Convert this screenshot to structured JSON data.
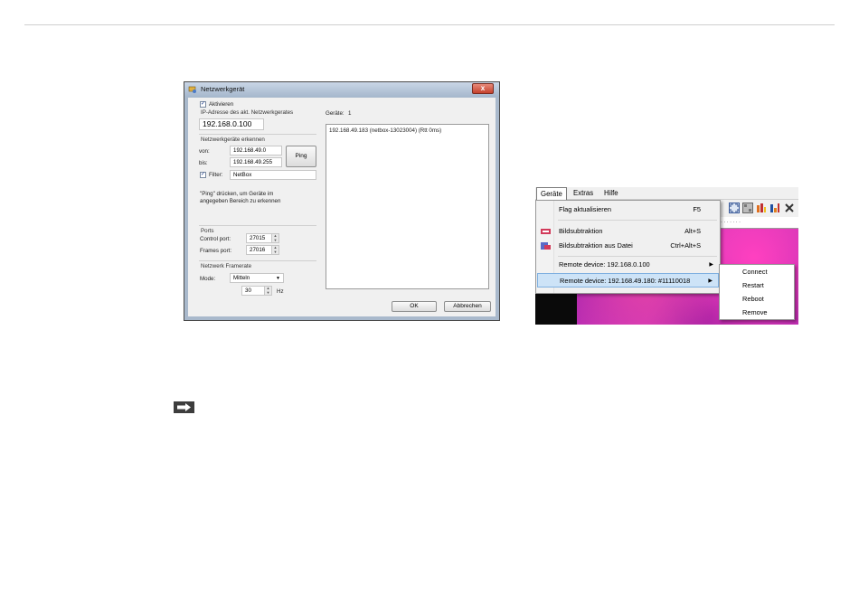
{
  "dialog": {
    "title": "Netzwerkgerät",
    "close_label": "x",
    "activate_label": "Aktivieren",
    "ip_section_label": "IP-Adresse des akt. Netzwerkgerates",
    "ip_value": "192.168.0.100",
    "discover_section_label": "Netzwerkgeräte erkennen",
    "from_label": "von:",
    "from_value": "192.168.49.0",
    "to_label": "bis:",
    "to_value": "192.168.49.255",
    "ping_label": "Ping",
    "filter_label": "Filter:",
    "filter_value": "NetBox",
    "hint_line1": "\"Ping\" drücken, um Geräte im",
    "hint_line2": "angegeben Bereich zu erkennen",
    "ports_section_label": "Ports",
    "control_port_label": "Control port:",
    "control_port_value": "27015",
    "frames_port_label": "Frames port:",
    "frames_port_value": "27016",
    "framerate_section_label": "Netzwerk Framerate",
    "mode_label": "Mode:",
    "mode_value": "Mitteln",
    "hz_value": "30",
    "hz_label": "Hz",
    "devices_label": "Geräte:",
    "devices_count": "1",
    "device_entry": "192.168.49.183 (netbox-13023004) (Rtt 0ms)",
    "ok_label": "OK",
    "cancel_label": "Abbrechen"
  },
  "menu": {
    "menubar": [
      "Geräte",
      "Extras",
      "Hilfe"
    ],
    "items": [
      {
        "label": "Flag aktualisieren",
        "shortcut": "F5"
      },
      {
        "label": "Bildsubtraktion",
        "shortcut": "Alt+S"
      },
      {
        "label": "Bildsubtraktion aus Datei",
        "shortcut": "Ctrl+Alt+S"
      },
      {
        "label": "Remote device: 192.168.0.100",
        "shortcut": ""
      },
      {
        "label": "Remote device: 192.168.49.180:  #11110018",
        "shortcut": ""
      }
    ],
    "submenu": [
      "Connect",
      "Restart",
      "Reboot",
      "Remove"
    ],
    "ruler_text": "·  ·  ·  ·  ·  ·  ·"
  }
}
